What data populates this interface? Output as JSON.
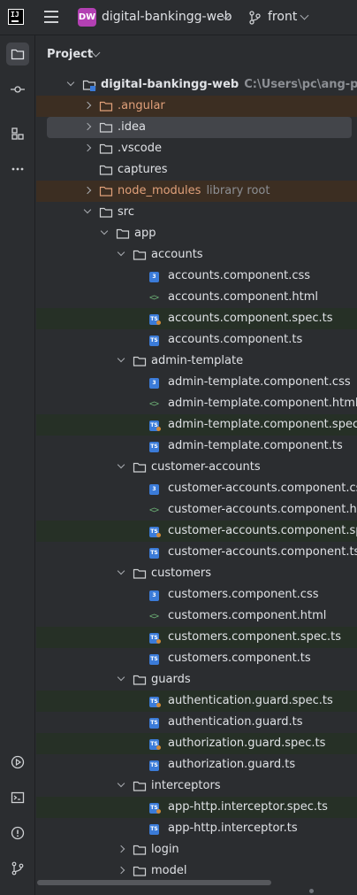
{
  "titlebar": {
    "project_badge": "DW",
    "project_name": "digital-bankingg-web",
    "branch": "front"
  },
  "panel": {
    "title": "Project"
  },
  "tree": [
    {
      "label": "digital-bankingg-web",
      "hint": "C:\\Users\\pc\\ang-proj\\digital",
      "depth": 0,
      "kind": "root",
      "arrow": "open"
    },
    {
      "label": ".angular",
      "depth": 1,
      "kind": "folder-orange",
      "arrow": "closed",
      "style": "ignored"
    },
    {
      "label": ".idea",
      "depth": 1,
      "kind": "folder",
      "arrow": "closed",
      "style": "selected"
    },
    {
      "label": ".vscode",
      "depth": 1,
      "kind": "folder",
      "arrow": "closed"
    },
    {
      "label": "captures",
      "depth": 1,
      "kind": "folder",
      "arrow": "none"
    },
    {
      "label": "node_modules",
      "hint": "library root",
      "depth": 1,
      "kind": "folder-orange",
      "arrow": "closed",
      "style": "ignored"
    },
    {
      "label": "src",
      "depth": 1,
      "kind": "folder",
      "arrow": "open"
    },
    {
      "label": "app",
      "depth": 2,
      "kind": "folder",
      "arrow": "open"
    },
    {
      "label": "accounts",
      "depth": 3,
      "kind": "folder",
      "arrow": "open"
    },
    {
      "label": "accounts.component.css",
      "depth": 4,
      "kind": "css"
    },
    {
      "label": "accounts.component.html",
      "depth": 4,
      "kind": "html"
    },
    {
      "label": "accounts.component.spec.ts",
      "depth": 4,
      "kind": "spec",
      "style": "spec"
    },
    {
      "label": "accounts.component.ts",
      "depth": 4,
      "kind": "ts"
    },
    {
      "label": "admin-template",
      "depth": 3,
      "kind": "folder",
      "arrow": "open"
    },
    {
      "label": "admin-template.component.css",
      "depth": 4,
      "kind": "css"
    },
    {
      "label": "admin-template.component.html",
      "depth": 4,
      "kind": "html"
    },
    {
      "label": "admin-template.component.spec.ts",
      "depth": 4,
      "kind": "spec",
      "style": "spec"
    },
    {
      "label": "admin-template.component.ts",
      "depth": 4,
      "kind": "ts"
    },
    {
      "label": "customer-accounts",
      "depth": 3,
      "kind": "folder",
      "arrow": "open"
    },
    {
      "label": "customer-accounts.component.css",
      "depth": 4,
      "kind": "css"
    },
    {
      "label": "customer-accounts.component.html",
      "depth": 4,
      "kind": "html"
    },
    {
      "label": "customer-accounts.component.spec.",
      "depth": 4,
      "kind": "spec",
      "style": "spec"
    },
    {
      "label": "customer-accounts.component.ts",
      "depth": 4,
      "kind": "ts"
    },
    {
      "label": "customers",
      "depth": 3,
      "kind": "folder",
      "arrow": "open"
    },
    {
      "label": "customers.component.css",
      "depth": 4,
      "kind": "css"
    },
    {
      "label": "customers.component.html",
      "depth": 4,
      "kind": "html"
    },
    {
      "label": "customers.component.spec.ts",
      "depth": 4,
      "kind": "spec",
      "style": "spec"
    },
    {
      "label": "customers.component.ts",
      "depth": 4,
      "kind": "ts"
    },
    {
      "label": "guards",
      "depth": 3,
      "kind": "folder",
      "arrow": "open"
    },
    {
      "label": "authentication.guard.spec.ts",
      "depth": 4,
      "kind": "spec",
      "style": "spec"
    },
    {
      "label": "authentication.guard.ts",
      "depth": 4,
      "kind": "ts"
    },
    {
      "label": "authorization.guard.spec.ts",
      "depth": 4,
      "kind": "spec",
      "style": "spec"
    },
    {
      "label": "authorization.guard.ts",
      "depth": 4,
      "kind": "ts"
    },
    {
      "label": "interceptors",
      "depth": 3,
      "kind": "folder",
      "arrow": "open"
    },
    {
      "label": "app-http.interceptor.spec.ts",
      "depth": 4,
      "kind": "spec",
      "style": "spec"
    },
    {
      "label": "app-http.interceptor.ts",
      "depth": 4,
      "kind": "ts"
    },
    {
      "label": "login",
      "depth": 3,
      "kind": "folder",
      "arrow": "closed"
    },
    {
      "label": "model",
      "depth": 3,
      "kind": "folder",
      "arrow": "closed"
    }
  ],
  "icons": {
    "left_top": [
      "folder-icon",
      "commit-icon",
      "structure-icon",
      "more-icon"
    ],
    "left_bottom": [
      "run-icon",
      "terminal-icon",
      "problems-icon",
      "git-icon"
    ]
  },
  "colors": {
    "accent_badge": "#b340b3",
    "ignored_text": "#e0a07a",
    "ts_badge": "#3b7bd8",
    "html_icon": "#6aab73"
  }
}
